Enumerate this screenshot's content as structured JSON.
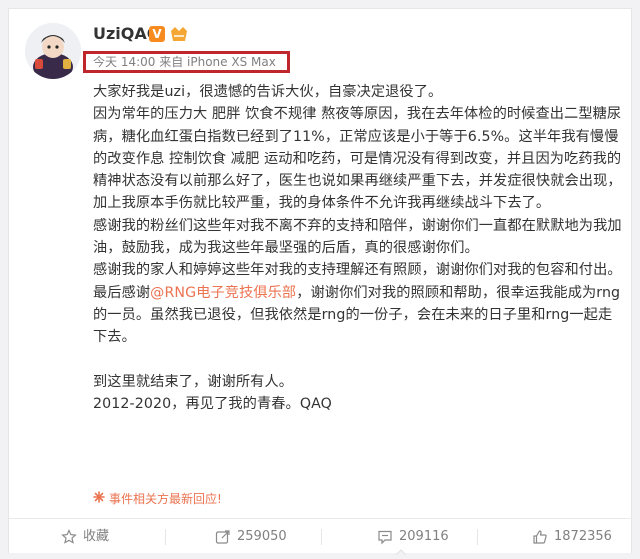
{
  "post": {
    "username": "UziQAQ",
    "verified_badge": "V",
    "meta": "今天 14:00 来自 iPhone XS Max",
    "paragraphs": [
      "大家好我是uzi，很遗憾的告诉大伙，自豪决定退役了。",
      "因为常年的压力大 肥胖 饮食不规律 熬夜等原因，我在去年体检的时候查出二型糖尿病，糖化血红蛋白指数已经到了11%，正常应该是小于等于6.5%。这半年我有慢慢的改变作息 控制饮食 减肥 运动和吃药，可是情况没有得到改变，并且因为吃药我的精神状态没有以前那么好了，医生也说如果再继续严重下去，并发症很快就会出现，加上我原本手伤就比较严重，我的身体条件不允许我再继续战斗下去了。",
      "感谢我的粉丝们这些年对我不离不弃的支持和陪伴，谢谢你们一直都在默默地为我加油，鼓励我，成为我这些年最坚强的后盾，真的很感谢你们。",
      "感谢我的家人和婷婷这些年对我的支持理解还有照顾，谢谢你们对我的包容和付出。"
    ],
    "final_prefix": "最后感谢",
    "mention": "@RNG电子竞技俱乐部",
    "final_suffix": "，谢谢你们对我的照顾和帮助，很幸运我能成为rng的一员。虽然我已退役，但我依然是rng的一份子，会在未来的日子里和rng一起走下去。",
    "closing_lines": [
      "到这里就结束了，谢谢所有人。",
      "2012-2020，再见了我的青春。QAQ"
    ],
    "notice": "事件相关方最新回应!"
  },
  "actions": {
    "favorite": "收藏",
    "repost": "259050",
    "comment": "209116",
    "like": "1872356"
  },
  "colors": {
    "accent": "#eb7350",
    "highlight_box": "#c0272d",
    "verified": "#f78b1f"
  }
}
